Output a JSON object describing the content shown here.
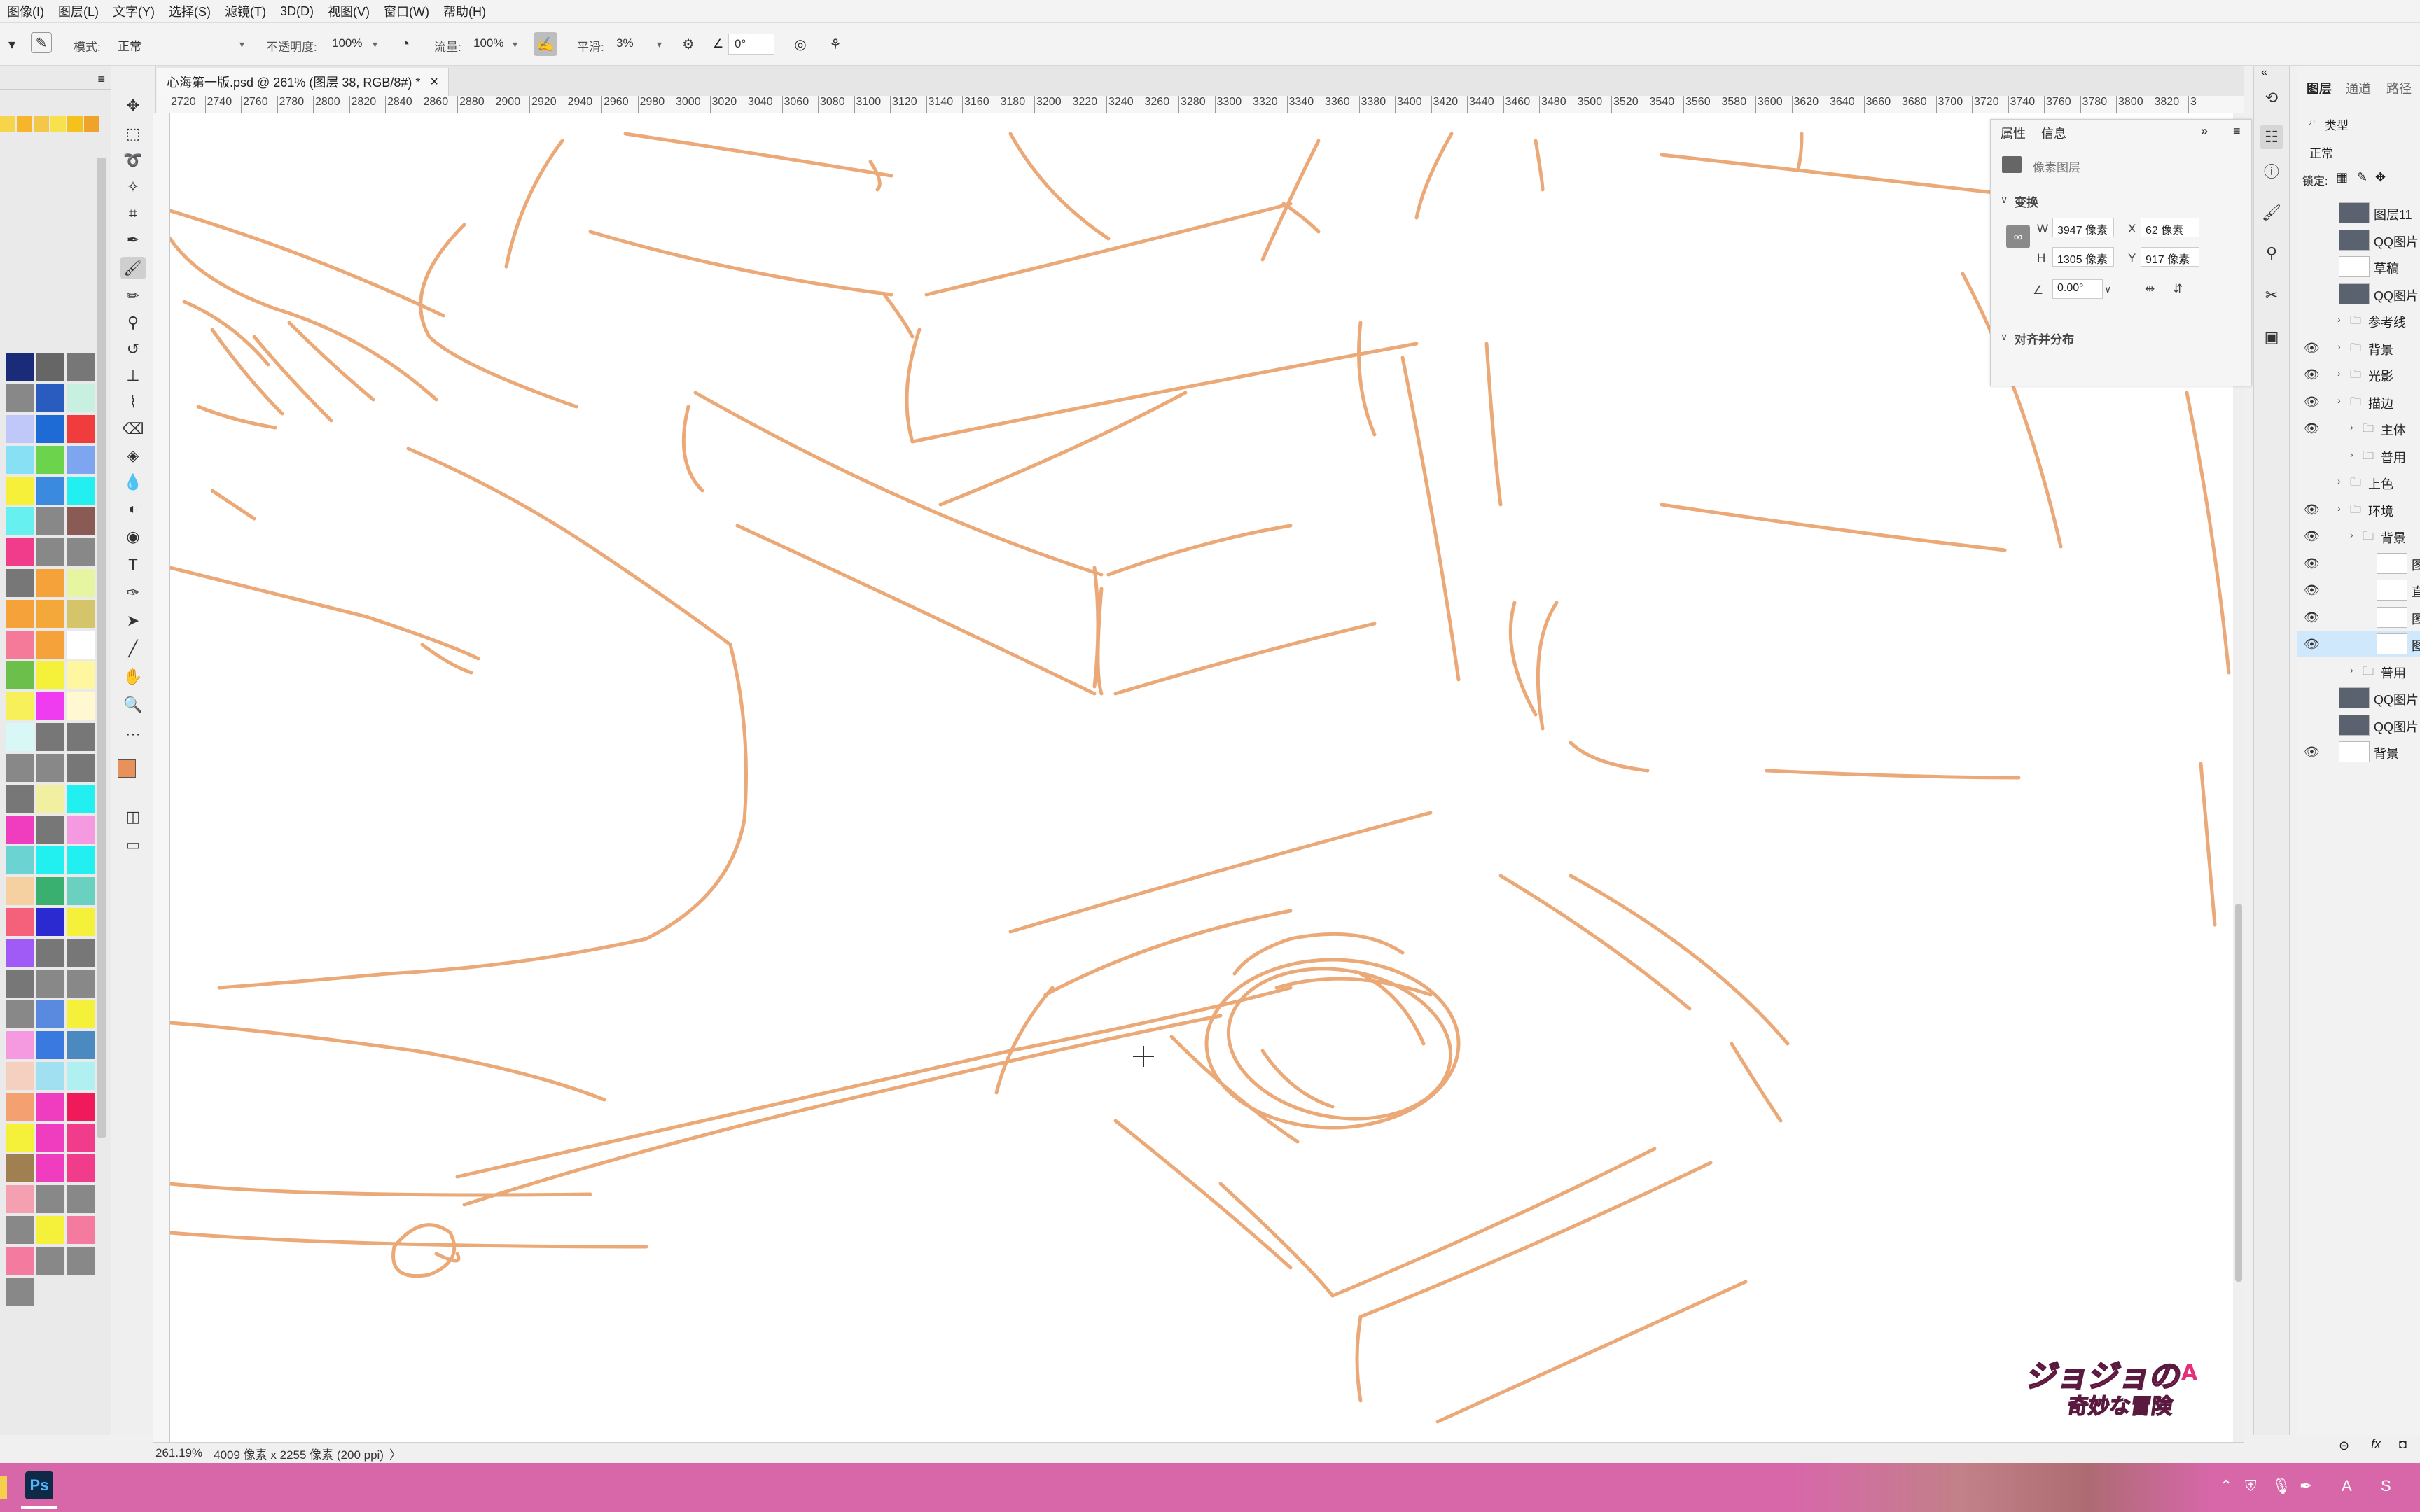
{
  "menu": [
    "图像(I)",
    "图层(L)",
    "文字(Y)",
    "选择(S)",
    "滤镜(T)",
    "3D(D)",
    "视图(V)",
    "窗口(W)",
    "帮助(H)"
  ],
  "options": {
    "mode_label": "模式:",
    "mode_value": "正常",
    "opacity_label": "不透明度:",
    "opacity_value": "100%",
    "flow_label": "流量:",
    "flow_value": "100%",
    "smoothing_label": "平滑:",
    "smoothing_value": "3%",
    "angle_value": "0°"
  },
  "document": {
    "tab_title": "心海第一版.psd @ 261% (图层 38, RGB/8#) *",
    "close": "×"
  },
  "ruler": {
    "h_ticks": [
      "2720",
      "2740",
      "2760",
      "2780",
      "2800",
      "2820",
      "2840",
      "2860",
      "2880",
      "2900",
      "2920",
      "2940",
      "2960",
      "2980",
      "3000",
      "3020",
      "3040",
      "3060",
      "3080",
      "3100",
      "3120",
      "3140",
      "3160",
      "3180",
      "3200",
      "3220",
      "3240",
      "3260",
      "3280",
      "3300",
      "3320",
      "3340",
      "3360",
      "3380",
      "3400",
      "3420",
      "3440",
      "3460",
      "3480",
      "3500",
      "3520",
      "3540",
      "3560",
      "3580",
      "3600",
      "3620",
      "3640",
      "3660",
      "3680",
      "3700",
      "3720",
      "3740",
      "3760",
      "3780",
      "3800",
      "3820",
      "3"
    ]
  },
  "status": {
    "zoom": "261.19%",
    "doc_info": "4009 像素 x 2255 像素 (200 ppi)",
    "arrow": "〉"
  },
  "properties": {
    "tab_properties": "属性",
    "tab_info": "信息",
    "layer_type": "像素图层",
    "section_transform": "变换",
    "w_label": "W",
    "w_value": "3947 像素",
    "h_label": "H",
    "h_value": "1305 像素",
    "x_label": "X",
    "x_value": "62 像素",
    "y_label": "Y",
    "y_value": "917 像素",
    "angle_value": "0.00°",
    "section_align": "对齐并分布"
  },
  "layers_panel": {
    "tabs": [
      "图层",
      "通道",
      "路径"
    ],
    "filter_label": "类型",
    "blend_mode": "正常",
    "lock_label": "锁定:",
    "rows": [
      {
        "name": "图层11",
        "visible": false
      },
      {
        "name": "QQ图片",
        "visible": false
      },
      {
        "name": "草稿",
        "visible": false
      },
      {
        "name": "QQ图片",
        "visible": false
      },
      {
        "name": "参考线",
        "visible": false
      },
      {
        "name": "背景",
        "visible": true
      },
      {
        "name": "光影",
        "visible": true
      },
      {
        "name": "描边",
        "visible": true
      },
      {
        "name": "主体",
        "visible": true
      },
      {
        "name": "普用",
        "visible": false
      },
      {
        "name": "上色",
        "visible": false
      },
      {
        "name": "环境",
        "visible": true
      },
      {
        "name": "背景",
        "visible": true
      },
      {
        "name": "图",
        "visible": true
      },
      {
        "name": "直",
        "visible": true
      },
      {
        "name": "图",
        "visible": true
      },
      {
        "name": "图",
        "visible": true
      },
      {
        "name": "普用",
        "visible": false
      },
      {
        "name": "QQ图片",
        "visible": false
      },
      {
        "name": "QQ图片",
        "visible": false
      },
      {
        "name": "背景",
        "visible": true
      }
    ]
  },
  "watermark_text": "ジョジョの奇妙な冒険",
  "colors": {
    "sketch": "#e9a06a",
    "foreground": "#e8915b",
    "taskbar": "#d867aa",
    "selected_layer": "#cfe8fb"
  },
  "taskbar": {
    "app": "Ps"
  }
}
